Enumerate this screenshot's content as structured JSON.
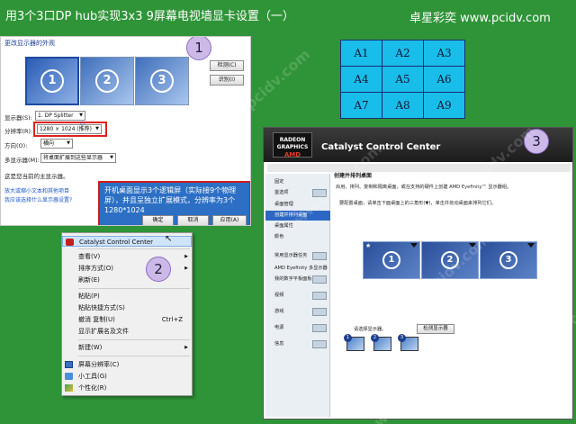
{
  "header": {
    "title": "用3个3口DP hub实现3x3 9屏幕电视墙显卡设置（一）",
    "brand": "卓星彩奕 www.pcidv.com"
  },
  "watermark": "www.pcidv.com",
  "colors": {
    "background": "#2f9438",
    "grid_cell": "#19bde9",
    "callout": "#2c6fc4",
    "highlight_border": "#e02020"
  },
  "step_markers": {
    "one": "1",
    "two": "2",
    "three": "3"
  },
  "grid": {
    "cells": [
      "A1",
      "A2",
      "A3",
      "A4",
      "A5",
      "A6",
      "A7",
      "A8",
      "A9"
    ]
  },
  "display_settings": {
    "heading": "更改显示器的外观",
    "monitors": [
      "1",
      "2",
      "3"
    ],
    "detect_button": "检测(C)",
    "identify_button": "识别(I)",
    "display_label": "显示器(S):",
    "display_value": "1. DP Splitter",
    "resolution_label": "分辨率(R):",
    "resolution_value": "1280 × 1024 (推荐)",
    "orientation_label": "方向(O):",
    "orientation_value": "横向",
    "multi_label": "多显示器(M):",
    "multi_value": "将桌面扩展到这些显示器",
    "main_text": "这是您当前的主显示器。",
    "link_1": "放大或缩小文本和其他项目",
    "link_2": "我应该选择什么显示器设置?",
    "ok": "确定",
    "cancel": "取消",
    "apply": "应用(A)",
    "callout": "开机桌面显示3个逻辑屏（实际接9个物理屏），并且呈独立扩展模式，分辨率为3个1280*1024"
  },
  "context_menu": {
    "items": [
      {
        "label": "Catalyst Control Center",
        "shortcut": "",
        "submenu": false,
        "highlighted": true
      },
      {
        "label": "查看(V)",
        "shortcut": "",
        "submenu": true
      },
      {
        "label": "排序方式(O)",
        "shortcut": "",
        "submenu": true
      },
      {
        "label": "刷新(E)",
        "shortcut": "",
        "submenu": false
      },
      {
        "label": "粘贴(P)",
        "shortcut": "",
        "submenu": false
      },
      {
        "label": "粘贴快捷方式(S)",
        "shortcut": "",
        "submenu": false
      },
      {
        "label": "撤消 复制(U)",
        "shortcut": "Ctrl+Z",
        "submenu": false
      },
      {
        "label": "显示扩展名及文件",
        "shortcut": "",
        "submenu": false
      },
      {
        "label": "新建(W)",
        "shortcut": "",
        "submenu": true
      },
      {
        "label": "屏幕分辨率(C)",
        "shortcut": "",
        "submenu": false
      },
      {
        "label": "小工具(G)",
        "shortcut": "",
        "submenu": false
      },
      {
        "label": "个性化(R)",
        "shortcut": "",
        "submenu": false
      }
    ]
  },
  "catalyst": {
    "logo_top": "RADEON",
    "logo_mid": "GRAPHICS",
    "logo_brand": "AMD",
    "title": "Catalyst Control Center",
    "section_title": "创建并排列桌面",
    "desc_1": "启用、排列、复制和隔离桌面，或在支持的硬件上创建 AMD Eyefinity™ 显示器组。",
    "desc_2": "要配置桌面，请单击下面桌面上的三角形(▼)，单击并拖动桌面来排列它们。",
    "sidebar": [
      "固定",
      "首选项",
      "桌面管理",
      "创建并排列桌面",
      "桌面属性",
      "颜色",
      "常用显示器任务",
      "AMD Eyefinity 多显示器",
      "我的数字平板面板",
      "视频",
      "游戏",
      "电源",
      "信息"
    ],
    "desktops": [
      "1",
      "2",
      "3"
    ],
    "unassigned_label": "请选择显示器。",
    "find_button": "检测显示器",
    "mini_monitors": [
      "1",
      "2",
      "3"
    ]
  }
}
